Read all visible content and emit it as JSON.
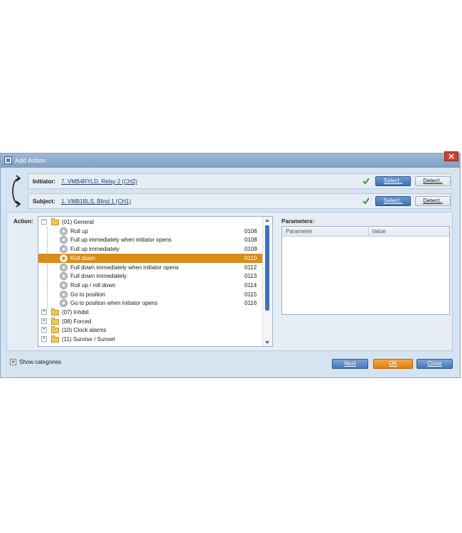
{
  "window": {
    "title": "Add Action",
    "close_glyph": "✕"
  },
  "initiator": {
    "label": "Initiator:",
    "value": "7. VMB4RYLD, Relay 2 (CH2)",
    "select": "Select..",
    "detect": "Detect.."
  },
  "subject": {
    "label": "Subject:",
    "value": "1. VMB1BLS, Blind 1 (CH1)",
    "select": "Select..",
    "detect": "Detect.."
  },
  "action": {
    "label": "Action:",
    "items": [
      {
        "type": "category",
        "expanded": true,
        "label": "(01) General"
      },
      {
        "type": "action",
        "label": "Roll up",
        "code": "0106"
      },
      {
        "type": "action",
        "label": "Full up immediately when initiator opens",
        "code": "0108"
      },
      {
        "type": "action",
        "label": "Full up immediately",
        "code": "0109"
      },
      {
        "type": "action",
        "label": "Roll down",
        "code": "0110",
        "selected": true
      },
      {
        "type": "action",
        "label": "Full down immediately when initiator opens",
        "code": "0112"
      },
      {
        "type": "action",
        "label": "Full down immediately",
        "code": "0113"
      },
      {
        "type": "action",
        "label": "Roll up / roll down",
        "code": "0114"
      },
      {
        "type": "action",
        "label": "Go to position",
        "code": "0115"
      },
      {
        "type": "action",
        "label": "Go to position when initiator opens",
        "code": "0116"
      },
      {
        "type": "category",
        "expanded": false,
        "label": "(07) Inhibit"
      },
      {
        "type": "category",
        "expanded": false,
        "label": "(08) Forced"
      },
      {
        "type": "category",
        "expanded": false,
        "label": "(10) Clock alarms"
      },
      {
        "type": "category",
        "expanded": false,
        "label": "(11) Sunrise / Sunset"
      }
    ]
  },
  "parameters": {
    "label": "Parameters:",
    "col_parameter": "Parameter",
    "col_value": "Value"
  },
  "footer": {
    "show_categories": "Show categories",
    "show_categories_checked": true,
    "next": "Next",
    "ok": "OK",
    "close": "Close"
  },
  "colors": {
    "selected_row": "#d98c17",
    "accent_button": "#4a78b8",
    "ok_button": "#e07e10"
  }
}
